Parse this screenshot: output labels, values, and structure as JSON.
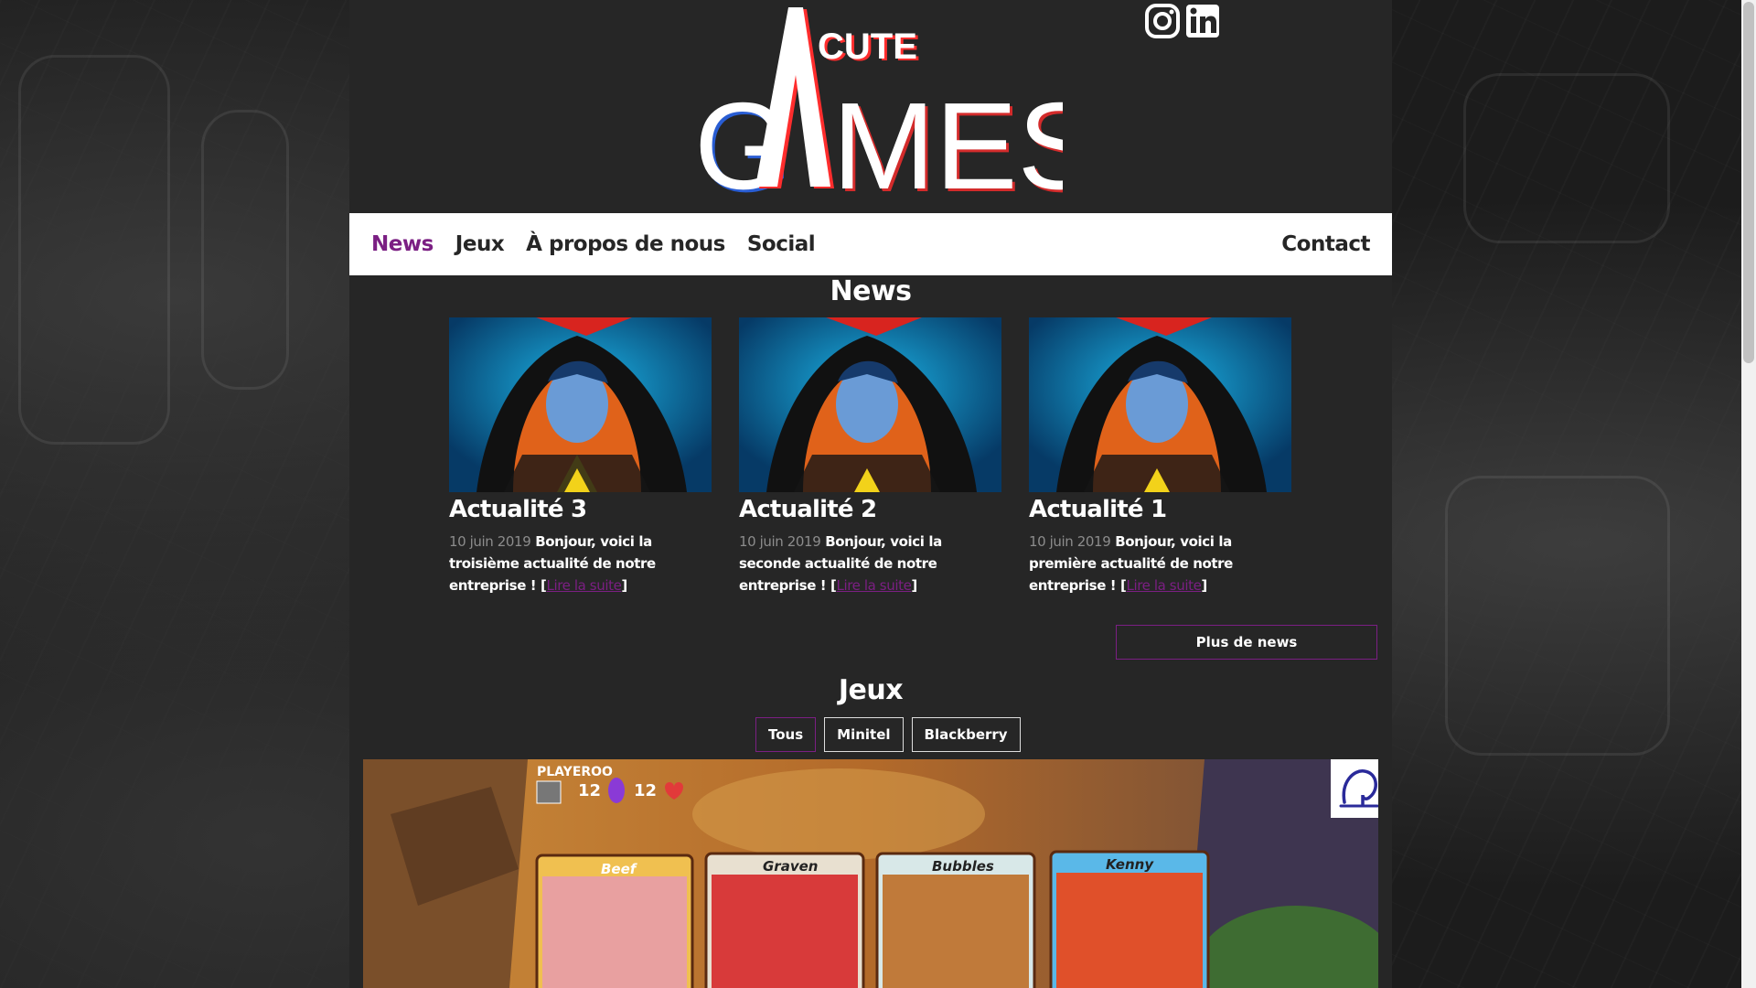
{
  "brand": {
    "logo_alt": "CUTE GAMES",
    "logo_small": "CUTE",
    "logo_big": "GAMES"
  },
  "social": [
    {
      "icon": "instagram-icon"
    },
    {
      "icon": "linkedin-icon"
    }
  ],
  "nav": {
    "items": [
      {
        "label": "News",
        "active": true
      },
      {
        "label": "Jeux",
        "active": false
      },
      {
        "label": "À propos de nous",
        "active": false
      },
      {
        "label": "Social",
        "active": false
      }
    ],
    "contact": "Contact"
  },
  "news": {
    "title": "News",
    "cards": [
      {
        "title": "Actualité 3",
        "date": "10 juin 2019",
        "text": "Bonjour, voici la troisième actualité de notre entreprise !",
        "more": "Lire la suite"
      },
      {
        "title": "Actualité 2",
        "date": "10 juin 2019",
        "text": "Bonjour, voici la seconde actualité de notre entreprise !",
        "more": "Lire la suite"
      },
      {
        "title": "Actualité 1",
        "date": "10 juin 2019",
        "text": "Bonjour, voici la première actualité de notre entreprise !",
        "more": "Lire la suite"
      }
    ],
    "more_button": "Plus de news"
  },
  "games": {
    "title": "Jeux",
    "filters": [
      {
        "label": "Tous",
        "active": true
      },
      {
        "label": "Minitel",
        "active": false
      },
      {
        "label": "Blackberry",
        "active": false
      }
    ],
    "banner": {
      "player_name": "PLAYEROO",
      "stat_gems": "12",
      "stat_hearts": "12",
      "cards": [
        "Beef",
        "Graven",
        "Bubbles",
        "Kenny"
      ]
    }
  },
  "colors": {
    "accent": "#7b1f83",
    "panel": "#262626",
    "nav_bg": "#ffffff"
  }
}
